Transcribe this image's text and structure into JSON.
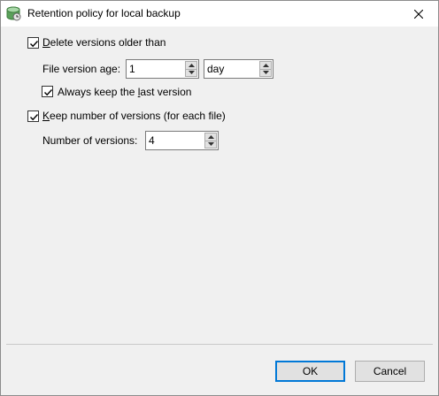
{
  "window": {
    "title": "Retention policy for local backup"
  },
  "icons": {
    "app": "backup-app-icon",
    "close": "close-icon",
    "spin_up": "up-arrow-icon",
    "spin_down": "down-arrow-icon"
  },
  "delete_versions": {
    "checked": true,
    "label_mnemonic": "D",
    "label_rest": "elete versions older than"
  },
  "file_version_age": {
    "label": "File version age:",
    "value": "1",
    "unit": "day"
  },
  "keep_last": {
    "checked": true,
    "label_pre": "Always keep the ",
    "label_mnemonic": "l",
    "label_post": "ast version"
  },
  "keep_number": {
    "checked": true,
    "label_mnemonic": "K",
    "label_rest": "eep number of versions (for each file)"
  },
  "number_of_versions": {
    "label": "Number of versions:",
    "value": "4"
  },
  "buttons": {
    "ok": "OK",
    "cancel": "Cancel"
  },
  "colors": {
    "accent": "#0078d7",
    "icon_green": "#5aa05a"
  }
}
